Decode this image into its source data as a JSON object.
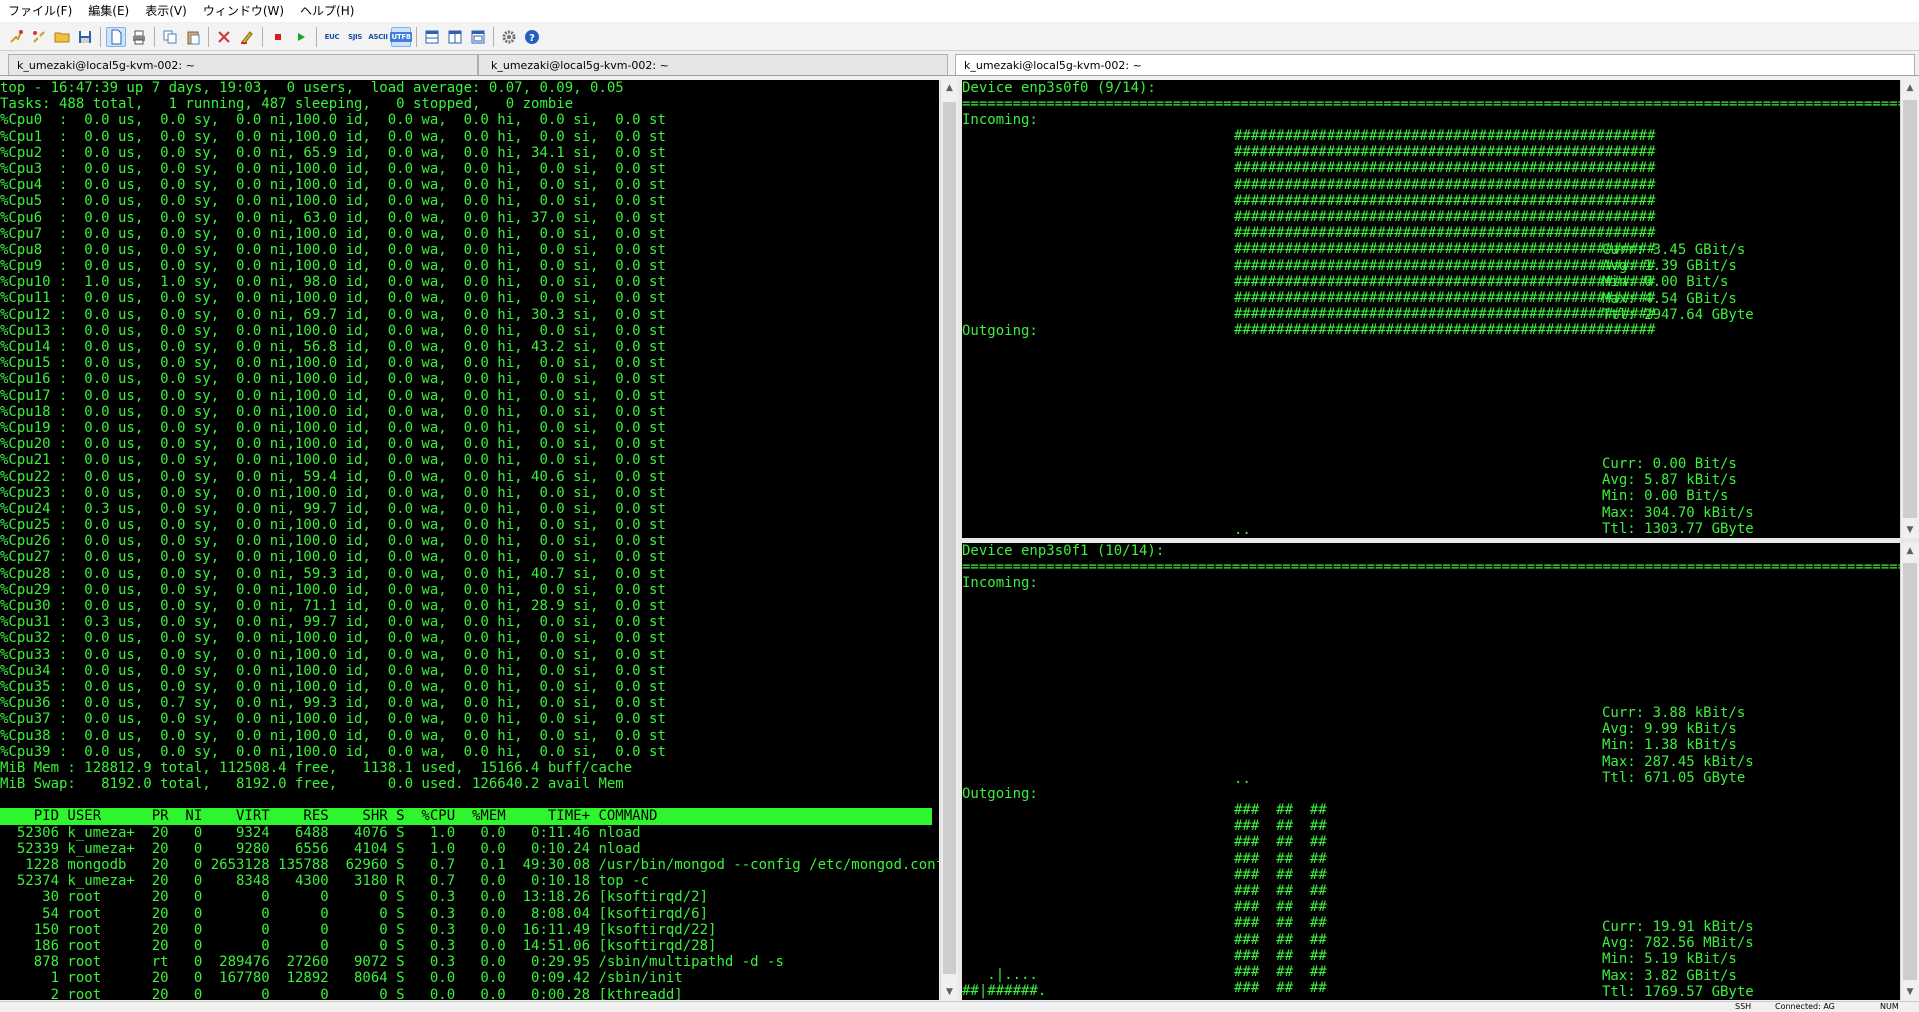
{
  "menu": [
    "ファイル(F)",
    "編集(E)",
    "表示(V)",
    "ウィンドウ(W)",
    "ヘルプ(H)"
  ],
  "toolbar": {
    "icons": [
      "connect-icon",
      "disconnect-icon",
      "open-folder-icon",
      "save-icon",
      "new-document-icon",
      "print-icon",
      "copy-icon",
      "paste-icon",
      "clear-icon",
      "highlight-icon",
      "stop-macro-icon",
      "play-macro-icon"
    ],
    "encodings": [
      "EUC",
      "SJIS",
      "ASCII",
      "UTF8"
    ],
    "active_encoding": "UTF8"
  },
  "tabs": [
    {
      "label": "k_umezaki@local5g-kvm-002: ~"
    },
    {
      "label": "k_umezaki@local5g-kvm-002: ~"
    },
    {
      "label": "k_umezaki@local5g-kvm-002: ~"
    }
  ],
  "top": {
    "summary": [
      "top - 16:47:39 up 7 days, 19:03,  0 users,  load average: 0.07, 0.09, 0.05",
      "Tasks: 488 total,   1 running, 487 sleeping,   0 stopped,   0 zombie"
    ],
    "cpus": [
      "%Cpu0  :  0.0 us,  0.0 sy,  0.0 ni,100.0 id,  0.0 wa,  0.0 hi,  0.0 si,  0.0 st",
      "%Cpu1  :  0.0 us,  0.0 sy,  0.0 ni,100.0 id,  0.0 wa,  0.0 hi,  0.0 si,  0.0 st",
      "%Cpu2  :  0.0 us,  0.0 sy,  0.0 ni, 65.9 id,  0.0 wa,  0.0 hi, 34.1 si,  0.0 st",
      "%Cpu3  :  0.0 us,  0.0 sy,  0.0 ni,100.0 id,  0.0 wa,  0.0 hi,  0.0 si,  0.0 st",
      "%Cpu4  :  0.0 us,  0.0 sy,  0.0 ni,100.0 id,  0.0 wa,  0.0 hi,  0.0 si,  0.0 st",
      "%Cpu5  :  0.0 us,  0.0 sy,  0.0 ni,100.0 id,  0.0 wa,  0.0 hi,  0.0 si,  0.0 st",
      "%Cpu6  :  0.0 us,  0.0 sy,  0.0 ni, 63.0 id,  0.0 wa,  0.0 hi, 37.0 si,  0.0 st",
      "%Cpu7  :  0.0 us,  0.0 sy,  0.0 ni,100.0 id,  0.0 wa,  0.0 hi,  0.0 si,  0.0 st",
      "%Cpu8  :  0.0 us,  0.0 sy,  0.0 ni,100.0 id,  0.0 wa,  0.0 hi,  0.0 si,  0.0 st",
      "%Cpu9  :  0.0 us,  0.0 sy,  0.0 ni,100.0 id,  0.0 wa,  0.0 hi,  0.0 si,  0.0 st",
      "%Cpu10 :  1.0 us,  1.0 sy,  0.0 ni, 98.0 id,  0.0 wa,  0.0 hi,  0.0 si,  0.0 st",
      "%Cpu11 :  0.0 us,  0.0 sy,  0.0 ni,100.0 id,  0.0 wa,  0.0 hi,  0.0 si,  0.0 st",
      "%Cpu12 :  0.0 us,  0.0 sy,  0.0 ni, 69.7 id,  0.0 wa,  0.0 hi, 30.3 si,  0.0 st",
      "%Cpu13 :  0.0 us,  0.0 sy,  0.0 ni,100.0 id,  0.0 wa,  0.0 hi,  0.0 si,  0.0 st",
      "%Cpu14 :  0.0 us,  0.0 sy,  0.0 ni, 56.8 id,  0.0 wa,  0.0 hi, 43.2 si,  0.0 st",
      "%Cpu15 :  0.0 us,  0.0 sy,  0.0 ni,100.0 id,  0.0 wa,  0.0 hi,  0.0 si,  0.0 st",
      "%Cpu16 :  0.0 us,  0.0 sy,  0.0 ni,100.0 id,  0.0 wa,  0.0 hi,  0.0 si,  0.0 st",
      "%Cpu17 :  0.0 us,  0.0 sy,  0.0 ni,100.0 id,  0.0 wa,  0.0 hi,  0.0 si,  0.0 st",
      "%Cpu18 :  0.0 us,  0.0 sy,  0.0 ni,100.0 id,  0.0 wa,  0.0 hi,  0.0 si,  0.0 st",
      "%Cpu19 :  0.0 us,  0.0 sy,  0.0 ni,100.0 id,  0.0 wa,  0.0 hi,  0.0 si,  0.0 st",
      "%Cpu20 :  0.0 us,  0.0 sy,  0.0 ni,100.0 id,  0.0 wa,  0.0 hi,  0.0 si,  0.0 st",
      "%Cpu21 :  0.0 us,  0.0 sy,  0.0 ni,100.0 id,  0.0 wa,  0.0 hi,  0.0 si,  0.0 st",
      "%Cpu22 :  0.0 us,  0.0 sy,  0.0 ni, 59.4 id,  0.0 wa,  0.0 hi, 40.6 si,  0.0 st",
      "%Cpu23 :  0.0 us,  0.0 sy,  0.0 ni,100.0 id,  0.0 wa,  0.0 hi,  0.0 si,  0.0 st",
      "%Cpu24 :  0.3 us,  0.0 sy,  0.0 ni, 99.7 id,  0.0 wa,  0.0 hi,  0.0 si,  0.0 st",
      "%Cpu25 :  0.0 us,  0.0 sy,  0.0 ni,100.0 id,  0.0 wa,  0.0 hi,  0.0 si,  0.0 st",
      "%Cpu26 :  0.0 us,  0.0 sy,  0.0 ni,100.0 id,  0.0 wa,  0.0 hi,  0.0 si,  0.0 st",
      "%Cpu27 :  0.0 us,  0.0 sy,  0.0 ni,100.0 id,  0.0 wa,  0.0 hi,  0.0 si,  0.0 st",
      "%Cpu28 :  0.0 us,  0.0 sy,  0.0 ni, 59.3 id,  0.0 wa,  0.0 hi, 40.7 si,  0.0 st",
      "%Cpu29 :  0.0 us,  0.0 sy,  0.0 ni,100.0 id,  0.0 wa,  0.0 hi,  0.0 si,  0.0 st",
      "%Cpu30 :  0.0 us,  0.0 sy,  0.0 ni, 71.1 id,  0.0 wa,  0.0 hi, 28.9 si,  0.0 st",
      "%Cpu31 :  0.3 us,  0.0 sy,  0.0 ni, 99.7 id,  0.0 wa,  0.0 hi,  0.0 si,  0.0 st",
      "%Cpu32 :  0.0 us,  0.0 sy,  0.0 ni,100.0 id,  0.0 wa,  0.0 hi,  0.0 si,  0.0 st",
      "%Cpu33 :  0.0 us,  0.0 sy,  0.0 ni,100.0 id,  0.0 wa,  0.0 hi,  0.0 si,  0.0 st",
      "%Cpu34 :  0.0 us,  0.0 sy,  0.0 ni,100.0 id,  0.0 wa,  0.0 hi,  0.0 si,  0.0 st",
      "%Cpu35 :  0.0 us,  0.0 sy,  0.0 ni,100.0 id,  0.0 wa,  0.0 hi,  0.0 si,  0.0 st",
      "%Cpu36 :  0.0 us,  0.7 sy,  0.0 ni, 99.3 id,  0.0 wa,  0.0 hi,  0.0 si,  0.0 st",
      "%Cpu37 :  0.0 us,  0.0 sy,  0.0 ni,100.0 id,  0.0 wa,  0.0 hi,  0.0 si,  0.0 st",
      "%Cpu38 :  0.0 us,  0.0 sy,  0.0 ni,100.0 id,  0.0 wa,  0.0 hi,  0.0 si,  0.0 st",
      "%Cpu39 :  0.0 us,  0.0 sy,  0.0 ni,100.0 id,  0.0 wa,  0.0 hi,  0.0 si,  0.0 st"
    ],
    "mem": [
      "MiB Mem : 128812.9 total, 112508.4 free,   1138.1 used,  15166.4 buff/cache",
      "MiB Swap:   8192.0 total,   8192.0 free,      0.0 used. 126640.2 avail Mem"
    ],
    "header": "    PID USER      PR  NI    VIRT    RES    SHR S  %CPU  %MEM     TIME+ COMMAND",
    "processes": [
      "  52306 k_umeza+  20   0    9324   6488   4076 S   1.0   0.0   0:11.46 nload",
      "  52339 k_umeza+  20   0    9280   6556   4104 S   1.0   0.0   0:10.24 nload",
      "   1228 mongodb   20   0 2653128 135788  62960 S   0.7   0.1  49:30.08 /usr/bin/mongod --config /etc/mongod.conf",
      "  52374 k_umeza+  20   0    8348   4300   3180 R   0.7   0.0   0:10.18 top -c",
      "     30 root      20   0       0      0      0 S   0.3   0.0  13:18.26 [ksoftirqd/2]",
      "     54 root      20   0       0      0      0 S   0.3   0.0   8:08.04 [ksoftirqd/6]",
      "    150 root      20   0       0      0      0 S   0.3   0.0  16:11.49 [ksoftirqd/22]",
      "    186 root      20   0       0      0      0 S   0.3   0.0  14:51.06 [ksoftirqd/28]",
      "    878 root      rt   0  289476  27260   9072 S   0.3   0.0   0:29.95 /sbin/multipathd -d -s",
      "      1 root      20   0  167780  12892   8064 S   0.0   0.0   0:09.42 /sbin/init",
      "      2 root      20   0       0      0      0 S   0.0   0.0   0:00.28 [kthreadd]"
    ]
  },
  "nload": [
    {
      "device": "Device enp3s0f0 (9/14):",
      "separator": "================================================================================================================================================================",
      "incoming_label": "Incoming:",
      "incoming_stats": [
        "Curr: 3.45 GBit/s",
        "Avg: 1.39 GBit/s",
        "Min: 0.00 Bit/s",
        "Max: 4.54 GBit/s",
        "Ttl: 2947.64 GByte"
      ],
      "outgoing_label": "Outgoing:",
      "outgoing_stats": [
        "Curr: 0.00 Bit/s",
        "Avg: 5.87 kBit/s",
        "Min: 0.00 Bit/s",
        "Max: 304.70 kBit/s",
        "Ttl: 1303.77 GByte"
      ],
      "outgoing_marker": ".."
    },
    {
      "device": "Device enp3s0f1 (10/14):",
      "separator": "================================================================================================================================================================",
      "incoming_label": "Incoming:",
      "incoming_stats": [
        "Curr: 3.88 kBit/s",
        "Avg: 9.99 kBit/s",
        "Min: 1.38 kBit/s",
        "Max: 287.45 kBit/s",
        "Ttl: 671.05 GByte"
      ],
      "incoming_marker": "..",
      "outgoing_label": "Outgoing:",
      "outgoing_stats": [
        "Curr: 19.91 kBit/s",
        "Avg: 782.56 MBit/s",
        "Min: 5.19 kBit/s",
        "Max: 3.82 GBit/s",
        "Ttl: 1769.57 GByte"
      ],
      "outgoing_tail": [
        "   .|....",
        "##|######."
      ]
    }
  ],
  "colors": {
    "terminal_bg": "#000000",
    "terminal_fg": "#3cf03c",
    "header_highlight": "#2ef52e",
    "graph_fg": "#3cf03c"
  },
  "statusbar": {
    "protocol": "SSH",
    "connection": "Connected: AG",
    "numlock": "NUM"
  }
}
